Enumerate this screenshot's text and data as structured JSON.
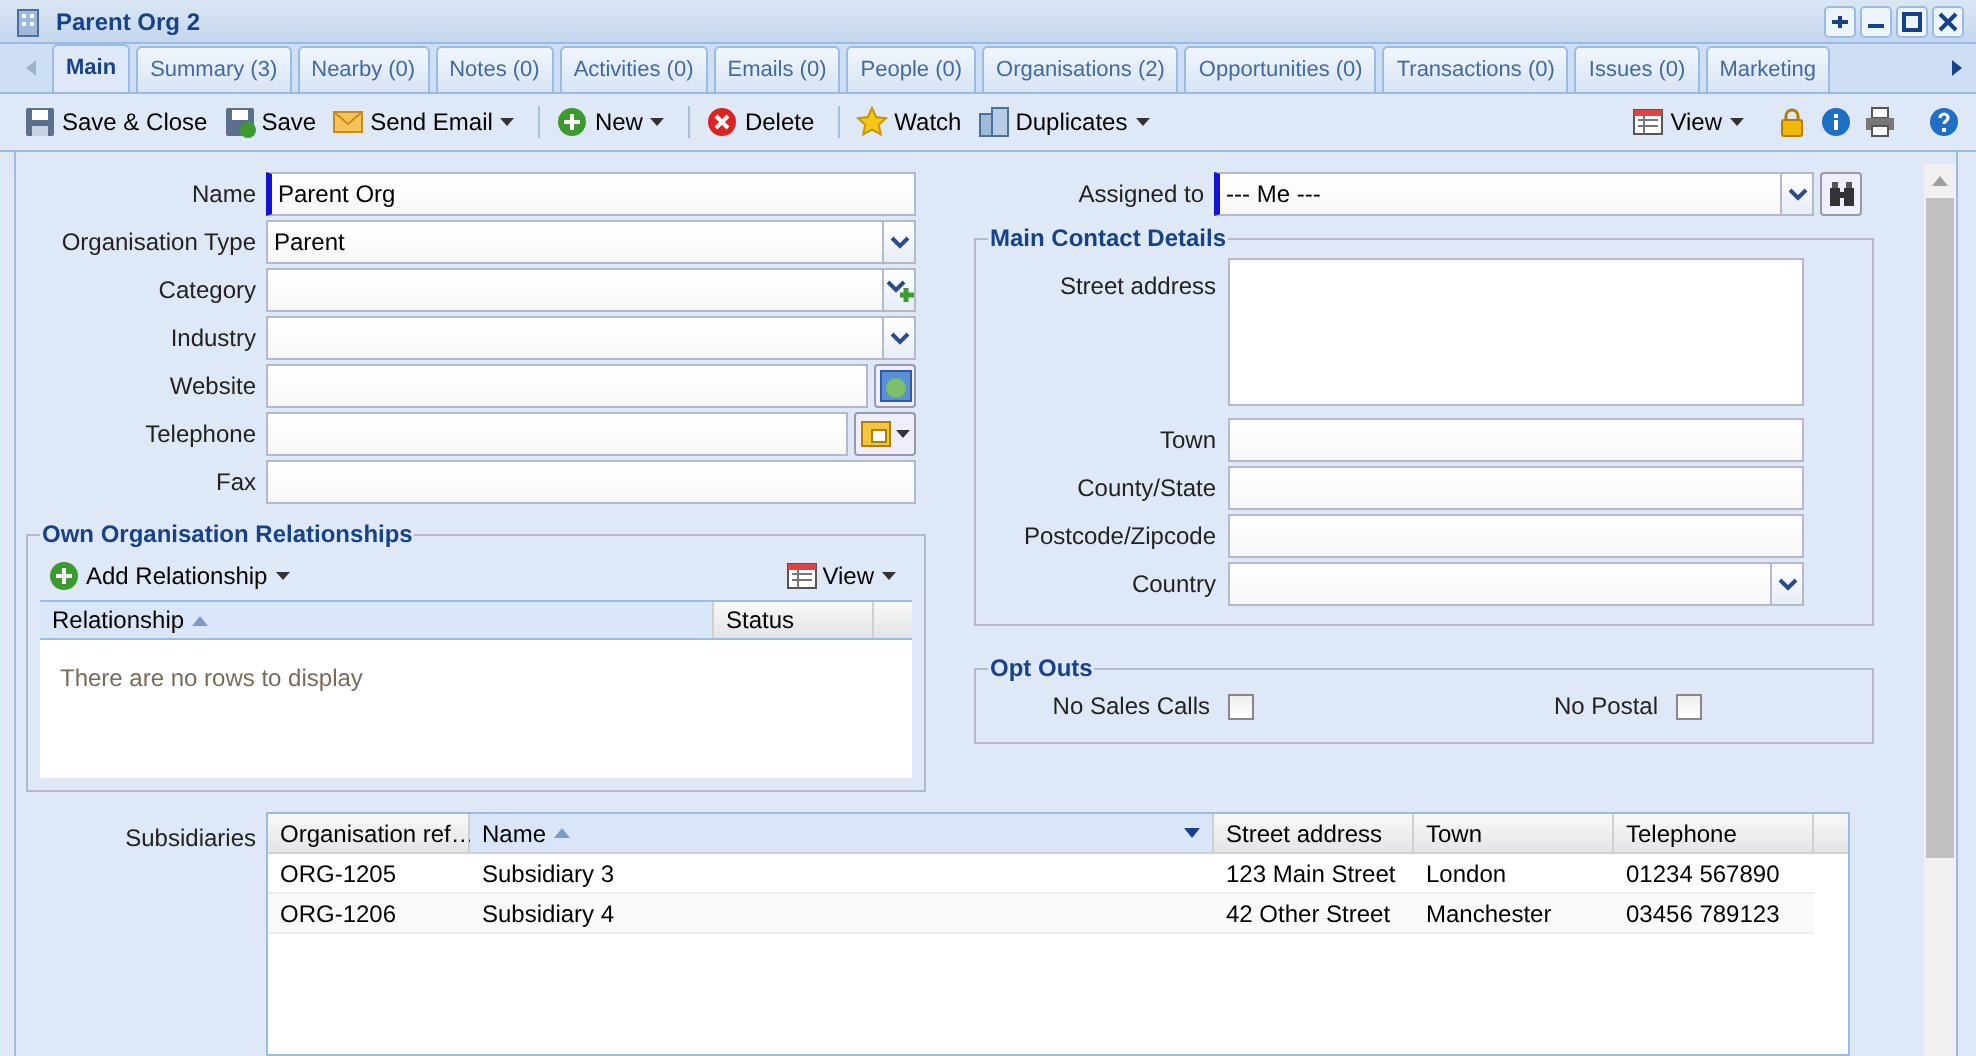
{
  "window": {
    "title": "Parent Org 2"
  },
  "tabs": [
    {
      "label": "Main",
      "selected": true
    },
    {
      "label": "Summary (3)",
      "selected": false
    },
    {
      "label": "Nearby (0)",
      "selected": false
    },
    {
      "label": "Notes (0)",
      "selected": false
    },
    {
      "label": "Activities (0)",
      "selected": false
    },
    {
      "label": "Emails (0)",
      "selected": false
    },
    {
      "label": "People (0)",
      "selected": false
    },
    {
      "label": "Organisations (2)",
      "selected": false
    },
    {
      "label": "Opportunities (0)",
      "selected": false
    },
    {
      "label": "Transactions (0)",
      "selected": false
    },
    {
      "label": "Issues (0)",
      "selected": false
    },
    {
      "label": "Marketing",
      "selected": false
    }
  ],
  "toolbar": {
    "groups": [
      [
        {
          "label": "Save & Close",
          "menu": false
        },
        {
          "label": "Save",
          "menu": false
        },
        {
          "label": "Send Email",
          "menu": true
        }
      ],
      [
        {
          "label": "New",
          "menu": true
        }
      ],
      [
        {
          "label": "Delete",
          "menu": false
        }
      ],
      [
        {
          "label": "Watch",
          "menu": false
        },
        {
          "label": "Duplicates",
          "menu": true
        }
      ]
    ],
    "view": {
      "label": "View",
      "menu": true
    }
  },
  "fields": [
    {
      "label": "Name",
      "kind": "text",
      "value": "Parent Org",
      "required": true
    },
    {
      "label": "Organisation Type",
      "kind": "combo",
      "value": "Parent",
      "required": false
    },
    {
      "label": "Category",
      "kind": "combo_add",
      "required": false
    },
    {
      "label": "Industry",
      "kind": "combo",
      "required": false
    },
    {
      "label": "Website",
      "kind": "web",
      "required": false
    },
    {
      "label": "Telephone",
      "kind": "phone",
      "required": false
    },
    {
      "label": "Fax",
      "kind": "text",
      "required": false
    }
  ],
  "relationships": {
    "title": "Own Organisation Relationships",
    "add_label": "Add Relationship",
    "view_label": "View",
    "columns": [
      {
        "label": "Relationship",
        "sorted": true
      },
      {
        "label": "Status",
        "sorted": false
      }
    ],
    "empty_text": "There are no rows to display"
  },
  "assigned_to": {
    "label": "Assigned to",
    "value": "--- Me ---",
    "required": true
  },
  "contact": {
    "title": "Main Contact Details",
    "fields": [
      {
        "label": "Street address",
        "kind": "textarea"
      },
      {
        "label": "Town",
        "kind": "text"
      },
      {
        "label": "County/State",
        "kind": "text"
      },
      {
        "label": "Postcode/Zipcode",
        "kind": "text"
      },
      {
        "label": "Country",
        "kind": "combo"
      }
    ]
  },
  "opt_outs": {
    "title": "Opt Outs",
    "items": [
      {
        "label": "No Sales Calls",
        "checked": false
      },
      {
        "label": "No Postal",
        "checked": false
      }
    ]
  },
  "subsidiaries": {
    "label": "Subsidiaries",
    "columns": [
      {
        "label": "Organisation ref…",
        "sorted": false
      },
      {
        "label": "Name",
        "sorted": true
      },
      {
        "label": "Street address",
        "sorted": false
      },
      {
        "label": "Town",
        "sorted": false
      },
      {
        "label": "Telephone",
        "sorted": false
      }
    ],
    "rows": [
      [
        "ORG-1205",
        "Subsidiary 3",
        "123 Main Street",
        "London",
        "01234 567890"
      ],
      [
        "ORG-1206",
        "Subsidiary 4",
        "42 Other Street",
        "Manchester",
        "03456 789123"
      ]
    ]
  }
}
